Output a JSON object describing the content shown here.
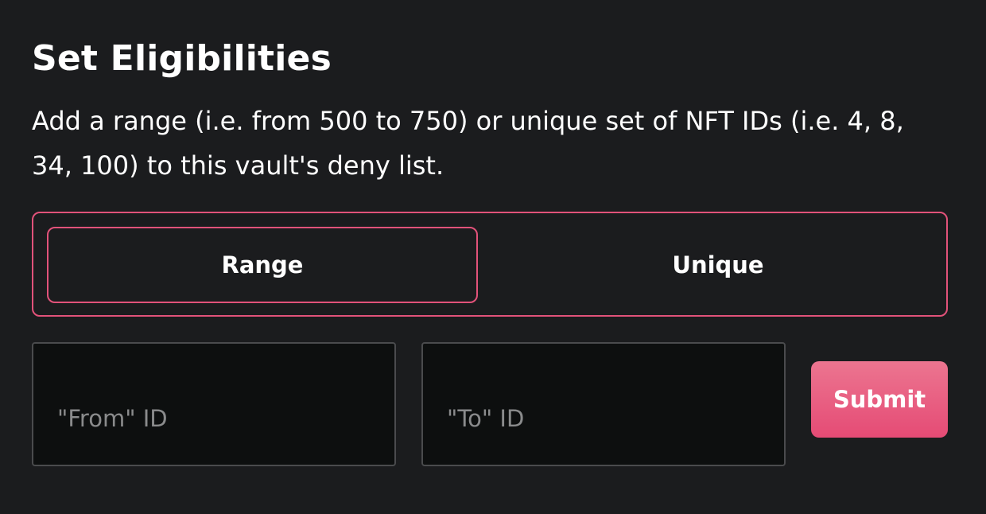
{
  "header": {
    "title": "Set Eligibilities",
    "description": "Add a range (i.e. from 500 to 750) or unique set of NFT IDs (i.e. 4, 8, 34, 100) to this vault's deny list."
  },
  "mode_toggle": {
    "selected": "Range",
    "options": [
      {
        "label": "Range"
      },
      {
        "label": "Unique"
      }
    ]
  },
  "form": {
    "from_placeholder": "\"From\" ID",
    "from_value": "",
    "to_placeholder": "\"To\" ID",
    "to_value": "",
    "submit_label": "Submit"
  },
  "colors": {
    "background": "#1b1c1e",
    "accent": "#e2527a",
    "input_background": "#0d0f0f",
    "input_border": "#4a4b4d",
    "submit_gradient_top": "#ec7590",
    "submit_gradient_bottom": "#e54b75"
  }
}
